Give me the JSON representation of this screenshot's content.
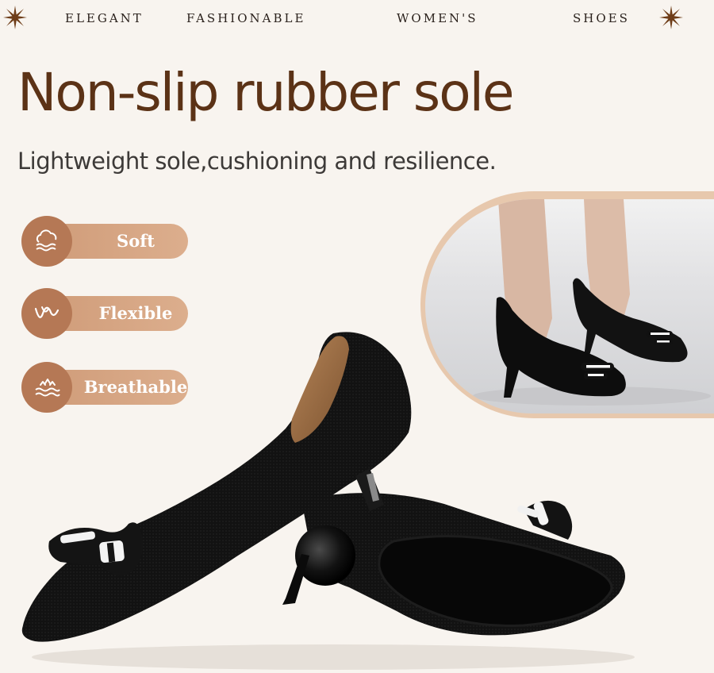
{
  "banner": {
    "words": [
      "ELEGANT",
      "FASHIONABLE",
      "WOMEN'S",
      "SHOES"
    ],
    "ornament_icon": "starburst-icon"
  },
  "headline": "Non-slip rubber sole",
  "subheadline": "Lightweight sole,cushioning and resilience.",
  "features": [
    {
      "label": "Soft",
      "icon": "cloud-icon"
    },
    {
      "label": "Flexible",
      "icon": "bend-wave-icon"
    },
    {
      "label": "Breathable",
      "icon": "airflow-icon"
    }
  ],
  "colors": {
    "background": "#f8f4ef",
    "headline": "#5b3216",
    "accent_disc": "#b57855",
    "pill": "#d4a383",
    "shoe": "#111111"
  }
}
